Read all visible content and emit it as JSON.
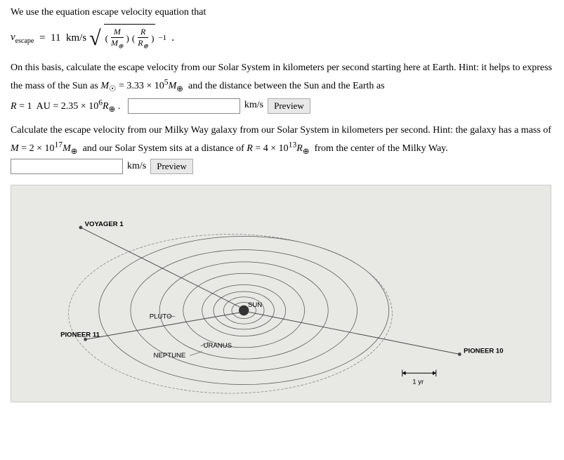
{
  "intro": {
    "text": "We use the equation escape velocity equation that"
  },
  "problem1": {
    "text_before": "On this basis, calculate the escape velocity from our Solar System in kilometers per second starting here at Earth. Hint: it helps to express the mass of the Sun as",
    "hint_math": "M☉ = 3.33 × 10⁵M⊕",
    "text_middle": "and the distance between the Sun and the Earth as",
    "hint_math2": "R = 1  AU = 2.35 × 10⁶R⊕",
    "text_end": ".",
    "input_placeholder": "",
    "unit_label": "km/s",
    "button_label": "Preview"
  },
  "problem2": {
    "text_before": "Calculate the escape velocity from our Milky Way galaxy from our Solar System in kilometers per second. Hint: the galaxy has a mass of",
    "hint_math1": "M = 2 × 10¹⁷M⊕",
    "text_middle": "and our Solar System sits at a distance of",
    "hint_math2": "R = 4 × 10¹³R⊕",
    "text_end": "from the center of the Milky Way.",
    "input_placeholder": "",
    "unit_label": "km/s",
    "button_label": "Preview"
  },
  "diagram": {
    "labels": {
      "voyager1": "VOYAGER 1",
      "pioneer11": "PIONEER 11",
      "pioneer10": "PIONEER 10",
      "pluto": "PLUTO",
      "neptune": "NEPTUNE",
      "uranus": "URANUS",
      "sun": "SUN",
      "year": "1 yr"
    }
  }
}
